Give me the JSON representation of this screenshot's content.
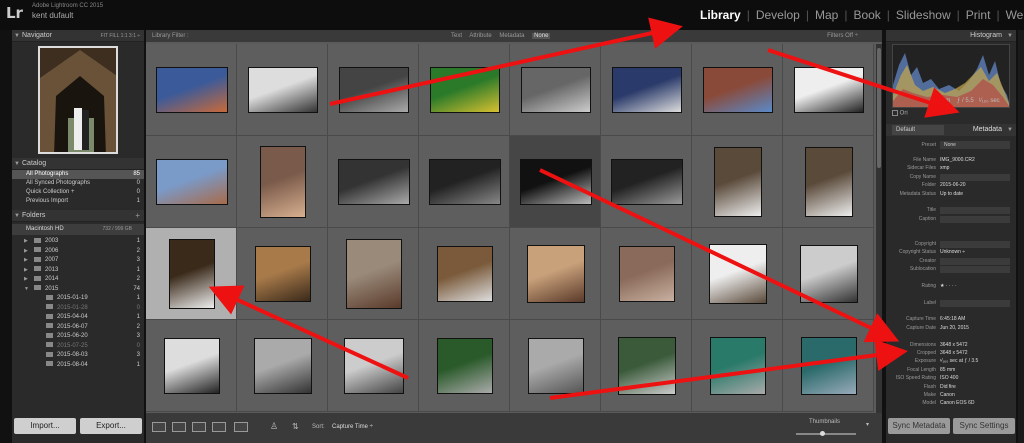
{
  "app": {
    "name": "Adobe Lightroom CC 2015",
    "user": "kent dufault",
    "logo": "Lr"
  },
  "modules": [
    {
      "label": "Library",
      "active": true
    },
    {
      "label": "Develop",
      "active": false
    },
    {
      "label": "Map",
      "active": false
    },
    {
      "label": "Book",
      "active": false
    },
    {
      "label": "Slideshow",
      "active": false
    },
    {
      "label": "Print",
      "active": false
    },
    {
      "label": "Web",
      "active": false
    }
  ],
  "navigator": {
    "title": "Navigator",
    "zoom": "FIT  FILL  1:1  3:1 ÷"
  },
  "catalog": {
    "title": "Catalog",
    "items": [
      {
        "label": "All Photographs",
        "count": "85"
      },
      {
        "label": "All Synced Photographs",
        "count": "0"
      },
      {
        "label": "Quick Collection +",
        "count": "0"
      },
      {
        "label": "Previous Import",
        "count": "1"
      }
    ]
  },
  "folders": {
    "title": "Folders",
    "disk": {
      "label": "Macintosh HD",
      "size": "732 / 999 GB"
    },
    "years": [
      {
        "label": "2003",
        "count": "1"
      },
      {
        "label": "2006",
        "count": "2"
      },
      {
        "label": "2007",
        "count": "3"
      },
      {
        "label": "2013",
        "count": "1"
      },
      {
        "label": "2014",
        "count": "2"
      },
      {
        "label": "2015",
        "count": "74"
      }
    ],
    "subfolders": [
      {
        "label": "2015-01-19",
        "count": "1"
      },
      {
        "label": "2015-01-28",
        "count": "0"
      },
      {
        "label": "2015-04-04",
        "count": "1"
      },
      {
        "label": "2015-06-07",
        "count": "2"
      },
      {
        "label": "2015-06-20",
        "count": "3"
      },
      {
        "label": "2015-07-25",
        "count": "0"
      },
      {
        "label": "2015-08-03",
        "count": "3"
      },
      {
        "label": "2015-08-04",
        "count": "1"
      }
    ]
  },
  "buttons": {
    "import": "Import...",
    "export": "Export...",
    "sync_metadata": "Sync Metadata",
    "sync_settings": "Sync Settings"
  },
  "filter": {
    "label": "Library Filter :",
    "options": [
      "Text",
      "Attribute",
      "Metadata",
      "None"
    ],
    "active": "None",
    "filters_off": "Filters Off ÷"
  },
  "toolbar": {
    "sort_label": "Sort:",
    "sort_value": "Capture Time ÷",
    "thumbnails_label": "Thumbnails"
  },
  "histogram": {
    "title": "Histogram",
    "focal": "85 mm",
    "aperture": "ƒ / 5.5",
    "shutter": "¹⁄₁₆₀ sec",
    "orig_label": "Ori"
  },
  "metadata": {
    "title": "Metadata",
    "preset_select": "Default",
    "preset_label": "Preset",
    "preset_value": "None",
    "rows": [
      {
        "label": "File Name",
        "value": "IMG_9000.CR2"
      },
      {
        "label": "Sidecar Files",
        "value": "xmp"
      },
      {
        "label": "Copy Name",
        "value": ""
      },
      {
        "label": "Folder",
        "value": "2015-06-20"
      },
      {
        "label": "Metadata Status",
        "value": "Up to date"
      },
      {
        "label": "",
        "value": ""
      },
      {
        "label": "Title",
        "value": ""
      },
      {
        "label": "Caption",
        "value": ""
      },
      {
        "label": "",
        "value": ""
      },
      {
        "label": "",
        "value": ""
      },
      {
        "label": "Copyright",
        "value": ""
      },
      {
        "label": "Copyright Status",
        "value": "Unknown ÷"
      },
      {
        "label": "Creator",
        "value": ""
      },
      {
        "label": "Sublocation",
        "value": ""
      },
      {
        "label": "",
        "value": ""
      },
      {
        "label": "Rating",
        "value": "★ · · · ·"
      },
      {
        "label": "",
        "value": ""
      },
      {
        "label": "Label",
        "value": ""
      },
      {
        "label": "",
        "value": ""
      },
      {
        "label": "Capture Time",
        "value": "6:45:18 AM"
      },
      {
        "label": "Capture Date",
        "value": "Jun 20, 2015"
      },
      {
        "label": "",
        "value": ""
      },
      {
        "label": "Dimensions",
        "value": "3648 x 5472"
      },
      {
        "label": "Cropped",
        "value": "3648 x 5472"
      },
      {
        "label": "Exposure",
        "value": "¹⁄₁₆₀ sec at ƒ / 3.5"
      },
      {
        "label": "Focal Length",
        "value": "85 mm"
      },
      {
        "label": "ISO Speed Rating",
        "value": "ISO 400"
      },
      {
        "label": "Flash",
        "value": "Did fire"
      },
      {
        "label": "Make",
        "value": "Canon"
      },
      {
        "label": "Model",
        "value": "Canon EOS 6D"
      }
    ]
  }
}
